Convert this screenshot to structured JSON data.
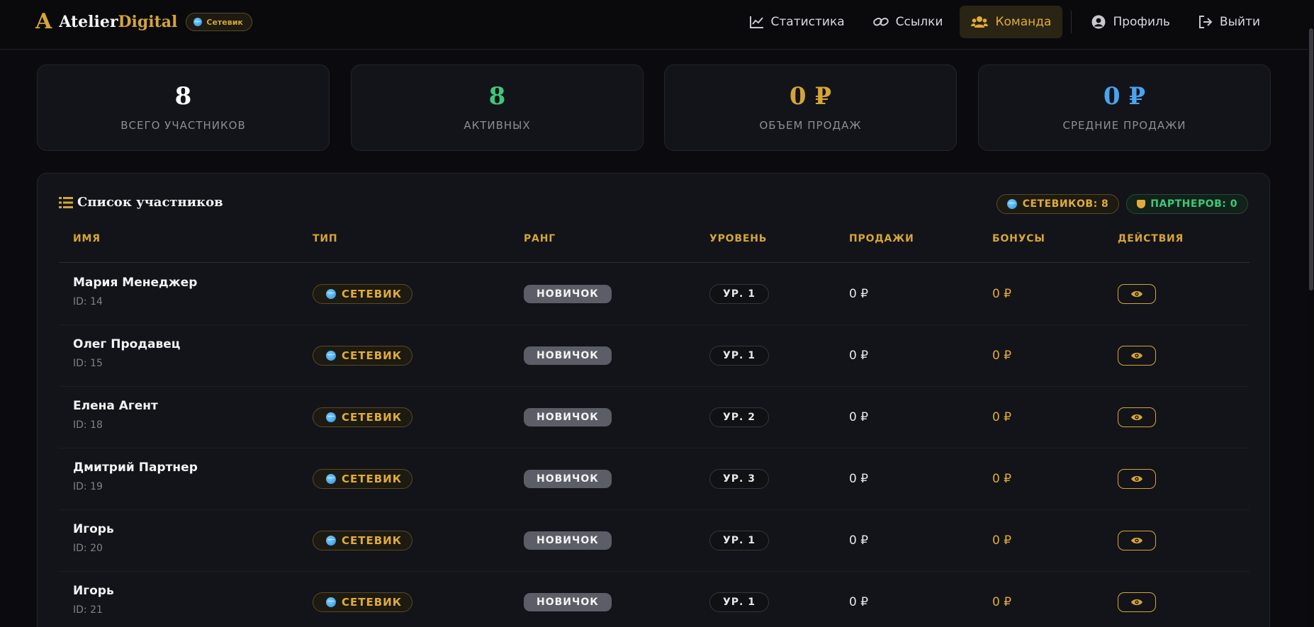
{
  "brand": {
    "mark": "A",
    "name_a": "Atelier",
    "name_b": "Digital",
    "role": "Сетевик"
  },
  "nav": [
    {
      "label": "Статистика",
      "icon": "chart-line-icon"
    },
    {
      "label": "Ссылки",
      "icon": "link-icon"
    },
    {
      "label": "Команда",
      "icon": "users-icon",
      "active": true
    },
    {
      "label": "Профиль",
      "icon": "user-circle-icon"
    },
    {
      "label": "Выйти",
      "icon": "sign-out-icon"
    }
  ],
  "stats": [
    {
      "value": "8",
      "label": "ВСЕГО УЧАСТНИКОВ",
      "color": "#ffffff"
    },
    {
      "value": "8",
      "label": "АКТИВНЫХ",
      "color": "#3ec87a"
    },
    {
      "value": "0 ₽",
      "label": "ОБЪЕМ ПРОДАЖ",
      "color": "#d4a537"
    },
    {
      "value": "0 ₽",
      "label": "СРЕДНИЕ ПРОДАЖИ",
      "color": "#4aa3ef"
    }
  ],
  "panel": {
    "title": "Список участников",
    "networkers_badge": "СЕТЕВИКОВ: 8",
    "partners_badge": "ПАРТНЕРОВ: 0"
  },
  "table": {
    "headers": [
      "ИМЯ",
      "ТИП",
      "РАНГ",
      "УРОВЕНЬ",
      "ПРОДАЖИ",
      "БОНУСЫ",
      "ДЕЙСТВИЯ"
    ],
    "rows": [
      {
        "name": "Мария Менеджер",
        "id": "ID: 14",
        "type": "СЕТЕВИК",
        "rank": "НОВИЧОК",
        "level": "УР. 1",
        "sales": "0 ₽",
        "bonus": "0 ₽"
      },
      {
        "name": "Олег Продавец",
        "id": "ID: 15",
        "type": "СЕТЕВИК",
        "rank": "НОВИЧОК",
        "level": "УР. 1",
        "sales": "0 ₽",
        "bonus": "0 ₽"
      },
      {
        "name": "Елена Агент",
        "id": "ID: 18",
        "type": "СЕТЕВИК",
        "rank": "НОВИЧОК",
        "level": "УР. 2",
        "sales": "0 ₽",
        "bonus": "0 ₽"
      },
      {
        "name": "Дмитрий Партнер",
        "id": "ID: 19",
        "type": "СЕТЕВИК",
        "rank": "НОВИЧОК",
        "level": "УР. 3",
        "sales": "0 ₽",
        "bonus": "0 ₽"
      },
      {
        "name": "Игорь",
        "id": "ID: 20",
        "type": "СЕТЕВИК",
        "rank": "НОВИЧОК",
        "level": "УР. 1",
        "sales": "0 ₽",
        "bonus": "0 ₽"
      },
      {
        "name": "Игорь",
        "id": "ID: 21",
        "type": "СЕТЕВИК",
        "rank": "НОВИЧОК",
        "level": "УР. 1",
        "sales": "0 ₽",
        "bonus": "0 ₽"
      }
    ]
  }
}
